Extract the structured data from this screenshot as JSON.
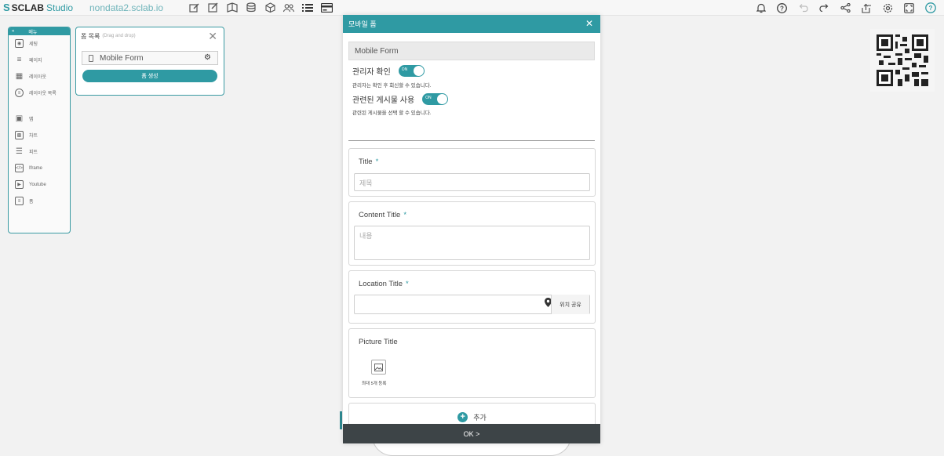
{
  "topbar": {
    "logo_mark": "S",
    "brand": "SCLAB",
    "studio": "Studio",
    "domain": "nondata2.sclab.io",
    "left_icons": [
      "edit-icon",
      "edit-box-icon",
      "book-icon",
      "database-icon",
      "cube-icon",
      "users-icon",
      "list-icon",
      "card-icon"
    ],
    "right_icons": [
      "bell-icon",
      "help-icon",
      "undo-icon",
      "redo-icon",
      "share-icon",
      "export-icon",
      "settings-icon",
      "fullscreen-icon",
      "info-icon"
    ]
  },
  "left_menu": {
    "header_label": "메뉴",
    "items": [
      {
        "icon": "setting-icon",
        "label": "세팅"
      },
      {
        "icon": "layers-icon",
        "label": "페이지"
      },
      {
        "icon": "layout-icon",
        "label": "레이아웃"
      },
      {
        "icon": "layout-list-icon",
        "label": "레이아웃 목록"
      },
      {
        "icon": "map-icon",
        "label": "맵"
      },
      {
        "icon": "chart-icon",
        "label": "차트"
      },
      {
        "icon": "table-icon",
        "label": "피트"
      },
      {
        "icon": "iframe-icon",
        "label": "Iframe"
      },
      {
        "icon": "youtube-icon",
        "label": "Youtube"
      },
      {
        "icon": "form-icon",
        "label": "폼"
      }
    ]
  },
  "form_list": {
    "title": "폼 목록",
    "subtitle": "(Drag and drop)",
    "items": [
      "Mobile Form"
    ],
    "create_button": "폼 생성"
  },
  "modal": {
    "title": "모바일 폼",
    "form_name": "Mobile Form",
    "toggle1": {
      "label": "관리자 확인",
      "state": "ON",
      "desc": "관리자는 확인 후 회신할 수 있습니다."
    },
    "toggle2": {
      "label": "관련된 게시물 사용",
      "state": "ON",
      "desc": "관련된 게시물을 선택 할 수 있습니다."
    },
    "fields": {
      "title": {
        "label": "Title",
        "required": "*",
        "placeholder": "제목"
      },
      "content": {
        "label": "Content Title",
        "required": "*",
        "placeholder": "내용"
      },
      "location": {
        "label": "Location Title",
        "required": "*",
        "share_button": "위치 공유"
      },
      "picture": {
        "label": "Picture Title",
        "max_note": "최대 5개 등록"
      }
    },
    "add_button": "추가",
    "ok_button": "OK >"
  },
  "colors": {
    "accent": "#2f9aa3",
    "footer": "#3d4447",
    "page_bg": "#f2f2f2"
  }
}
